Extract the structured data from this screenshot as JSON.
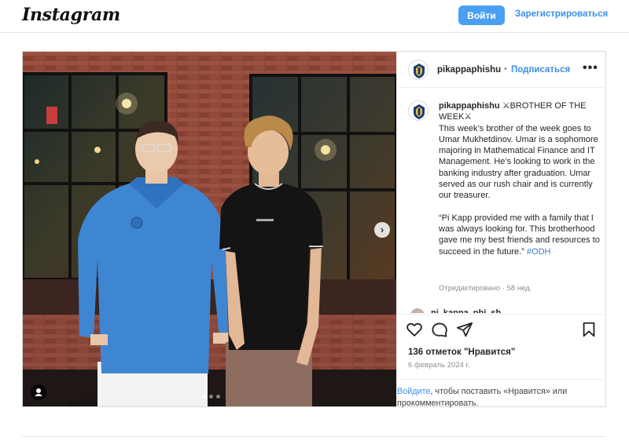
{
  "topbar": {
    "logo": "Instagram",
    "login_label": "Войти",
    "register_label": "Зарегистрироваться"
  },
  "post": {
    "username": "pikappaphishu",
    "separator": "•",
    "follow_label": "Подписаться",
    "more_label": "•••",
    "media": {
      "slide_count": 3,
      "active_slide": 1
    },
    "caption": {
      "username": "pikappaphishu",
      "title": "⚔BROTHER OF THE WEEK⚔",
      "body": "This week’s brother of the week goes to Umar Mukhetdinov. Umar is a sophomore majoring in Mathematical Finance and IT Management. He’s looking to work in the banking industry after graduation. Umar served as our rush chair and is currently our treasurer.",
      "quote": "“Pi Kapp provided me with a family that I was always looking for. This brotherhood gave me my best friends and resources to succeed in the future.”",
      "hashtag": "#ODH"
    },
    "edited_label": "Отредактировано · 58 нед.",
    "comment_peek_user": "pi_kappa_phi_sh",
    "likes_label": "136 отметок \"Нравится\"",
    "date_label": "6 февраль 2024 г.",
    "login_prompt": {
      "link": "Войдите",
      "text": ", чтобы поставить «Нравится» или прокомментировать."
    }
  },
  "icons": {
    "like": "heart-icon",
    "comment": "comment-icon",
    "share": "share-icon",
    "save": "bookmark-icon",
    "next": "chevron-right-icon",
    "tagged_user": "user-icon"
  },
  "colors": {
    "accent": "#4a9ff0",
    "link": "#3b8ee8",
    "muted": "#8e8e8e",
    "hashtag": "#3b7dbf"
  }
}
